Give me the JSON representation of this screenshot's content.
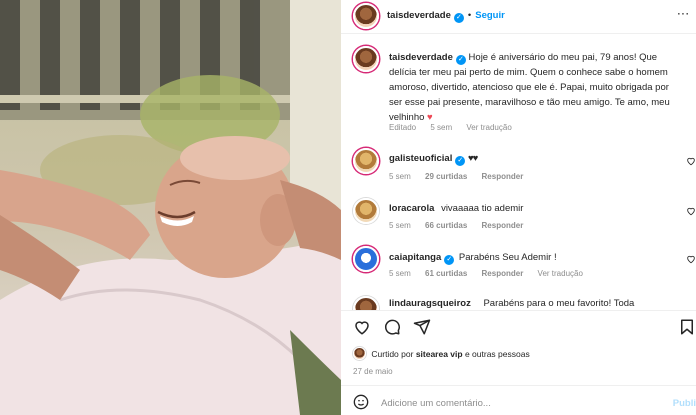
{
  "header": {
    "username": "taisdeverdade",
    "separator": "•",
    "follow_label": "Seguir"
  },
  "caption": {
    "username": "taisdeverdade",
    "text": "Hoje é aniversário do meu pai, 79 anos! Que delícia ter meu pai perto de mim. Quem o conhece sabe o homem amoroso, divertido, atencioso que ele é. Papai, muito obrigada por ser esse pai presente, maravilhoso e tão meu amigo. Te amo, meu velhinho",
    "heart": "♥",
    "edited": "Editado",
    "time": "5 sem",
    "see_translation": "Ver tradução"
  },
  "comments": [
    {
      "username": "galisteuoficial",
      "text": "♥♥",
      "time": "5 sem",
      "likes": "29 curtidas",
      "reply": "Responder",
      "translation": ""
    },
    {
      "username": "loracarola",
      "text": "vivaaaaa tio ademir",
      "time": "5 sem",
      "likes": "66 curtidas",
      "reply": "Responder",
      "translation": ""
    },
    {
      "username": "caiapitanga",
      "text": "Parabéns Seu Ademir !",
      "time": "5 sem",
      "likes": "61 curtidas",
      "reply": "Responder",
      "translation": "Ver tradução"
    },
    {
      "username": "lindauragsqueiroz",
      "text": "Parabéns para o meu favorito! Toda"
    }
  ],
  "likes": {
    "prefix": "Curtido por",
    "user": "sitearea vip",
    "suffix": "e outras pessoas",
    "date": "27 de maio"
  },
  "comment_input": {
    "placeholder": "Adicione um comentário...",
    "publish": "Publi"
  },
  "icons": {
    "verified": "verified-badge-icon",
    "like": "heart-icon",
    "comment": "comment-icon",
    "share": "share-icon",
    "save": "bookmark-icon",
    "emoji": "smiley-icon"
  },
  "colors": {
    "link_blue": "#0095f6",
    "muted": "#8e8e8e",
    "heart_red": "#ed4956"
  }
}
